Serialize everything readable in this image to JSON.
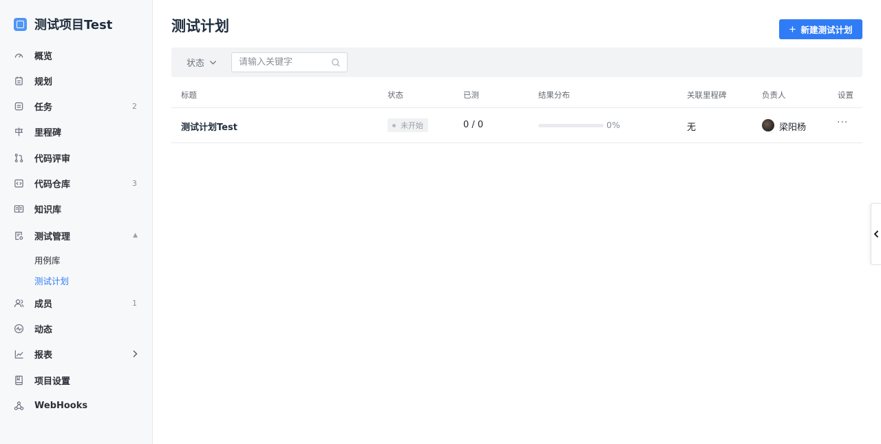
{
  "project": {
    "name": "测试项目Test"
  },
  "sidebar": {
    "items": [
      {
        "label": "概览",
        "icon": "dashboard-icon"
      },
      {
        "label": "规划",
        "icon": "calendar-icon"
      },
      {
        "label": "任务",
        "icon": "task-icon",
        "badge": "2"
      },
      {
        "label": "里程碑",
        "icon": "milestone-icon"
      },
      {
        "label": "代码评审",
        "icon": "merge-request-icon"
      },
      {
        "label": "代码仓库",
        "icon": "code-icon",
        "badge": "3"
      },
      {
        "label": "知识库",
        "icon": "book-icon"
      },
      {
        "label": "测试管理",
        "icon": "test-icon",
        "expanded": true
      },
      {
        "label": "成员",
        "icon": "members-icon",
        "badge": "1"
      },
      {
        "label": "动态",
        "icon": "activity-icon"
      },
      {
        "label": "报表",
        "icon": "chart-icon"
      },
      {
        "label": "项目设置",
        "icon": "settings-icon"
      },
      {
        "label": "WebHooks",
        "icon": "webhooks-icon"
      }
    ],
    "sub_items": [
      {
        "label": "用例库",
        "active": false
      },
      {
        "label": "测试计划",
        "active": true
      }
    ]
  },
  "main": {
    "title": "测试计划",
    "new_button": "新建测试计划",
    "filter": {
      "status_label": "状态",
      "search_placeholder": "请输入关键字"
    },
    "columns": [
      "标题",
      "状态",
      "已测",
      "结果分布",
      "关联里程碑",
      "负责人",
      "设置"
    ],
    "rows": [
      {
        "title": "测试计划Test",
        "status": "未开始",
        "tested": "0 / 0",
        "progress_percent": 0,
        "progress_label": "0%",
        "milestone": "无",
        "owner": "梁阳杨"
      }
    ]
  },
  "colors": {
    "accent": "#2f7cf6",
    "sidebar_bg": "#f7f8fa",
    "filter_bg": "#f2f3f5"
  }
}
